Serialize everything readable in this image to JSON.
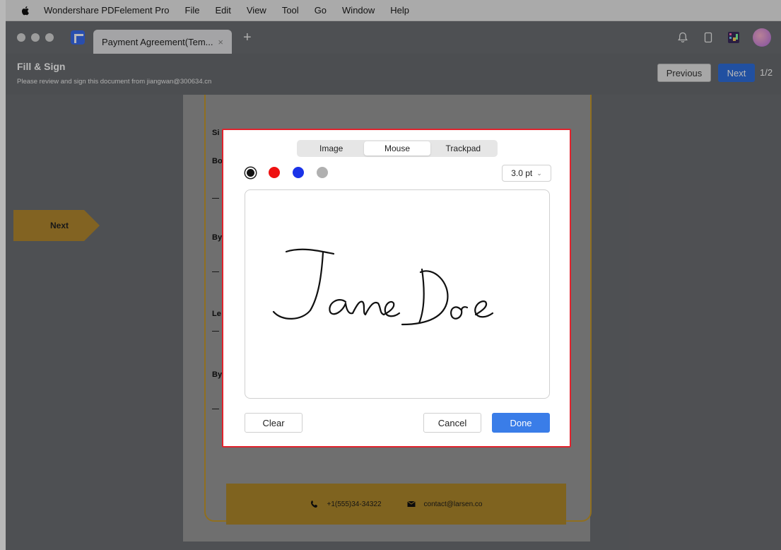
{
  "menubar": {
    "app_name": "Wondershare PDFelement Pro",
    "items": [
      "File",
      "Edit",
      "View",
      "Tool",
      "Go",
      "Window",
      "Help"
    ]
  },
  "tabbar": {
    "tab_title": "Payment Agreement(Tem...",
    "close_glyph": "×",
    "new_tab_glyph": "+",
    "icons": [
      "bell-icon",
      "device-icon",
      "app-grid-icon",
      "avatar"
    ]
  },
  "header": {
    "title": "Fill & Sign",
    "subtitle": "Please review and sign this document from jiangwan@300634.cn",
    "previous_label": "Previous",
    "next_label": "Next",
    "page_indicator": "1/2"
  },
  "document": {
    "next_arrow_label": "Next",
    "fragments": [
      "Si",
      "Bo",
      "By",
      "Le",
      "By"
    ],
    "footer": {
      "phone": "+1(555)34-34322",
      "email": "contact@larsen.co"
    },
    "accent_color": "#c89a2c"
  },
  "dialog": {
    "tabs": [
      {
        "label": "Image",
        "active": false
      },
      {
        "label": "Mouse",
        "active": true
      },
      {
        "label": "Trackpad",
        "active": false
      }
    ],
    "colors": [
      {
        "name": "black",
        "hex": "#111111",
        "selected": true
      },
      {
        "name": "red",
        "hex": "#ee1111",
        "selected": false
      },
      {
        "name": "blue",
        "hex": "#1a33e8",
        "selected": false
      },
      {
        "name": "gray",
        "hex": "#b0b0b0",
        "selected": false
      }
    ],
    "stroke_width": "3.0 pt",
    "signature_text": "Jane Doe",
    "clear_label": "Clear",
    "cancel_label": "Cancel",
    "done_label": "Done"
  }
}
